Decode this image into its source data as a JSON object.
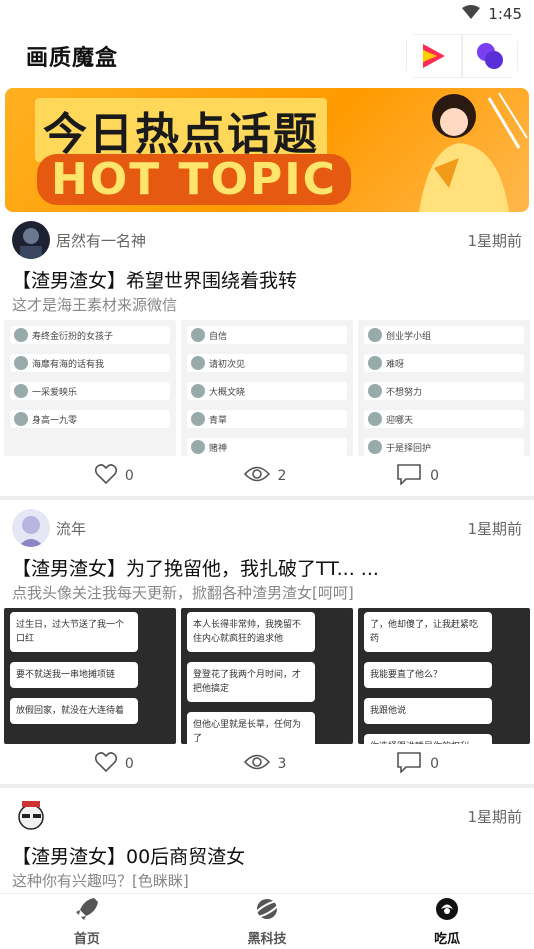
{
  "status_bar": {
    "time": "1:45",
    "wifi_icon": "wifi-icon"
  },
  "header": {
    "title": "画质魔盒",
    "icons": [
      "video-play-icon",
      "bubbles-icon"
    ]
  },
  "banner": {
    "title_cn": "今日热点话题",
    "title_en": "HOT TOPIC"
  },
  "posts": [
    {
      "author": "居然有一名神",
      "time": "1星期前",
      "title": "【渣男渣女】希望世界围绕着我转",
      "subtitle": "这才是海王素材来源微信",
      "likes": "0",
      "views": "2",
      "comments": "0",
      "thumb_lines": [
        [
          "寿终金衍扮的女孩子",
          "海靡有海的话有我",
          "一采爱映乐",
          "身高一九零"
        ],
        [
          "自信",
          "请初次见",
          "大概文晓",
          "青草",
          "赌神"
        ],
        [
          "创业学小组",
          "难呀",
          "不想努力",
          "迎哪天",
          "于是择回护"
        ]
      ]
    },
    {
      "author": "流年",
      "time": "1星期前",
      "title": "【渣男渣女】为了挽留他，我扎破了TT... ...",
      "subtitle": "点我头像关注我每天更新，掀翻各种渣男渣女[呵呵]",
      "likes": "0",
      "views": "3",
      "comments": "0",
      "thumb_lines": [
        [
          "过生日，过大节送了我一个口红",
          "要不就送我一串地摊项链",
          "放假回家，就没在大连待着"
        ],
        [
          "本人长得非常帅，我挽留不住内心就疯狂的追求他",
          "登登花了我两个月时间，才把他搞定",
          "但他心里就是长草，任何为了"
        ],
        [
          "了，他却傻了，让我赶紧吃药",
          "我能要直了他么？",
          "我跟他说",
          "你选择跟谁睡是你的权利，生不生是我的权利"
        ]
      ]
    },
    {
      "author": "",
      "time": "1星期前",
      "title": "【渣男渣女】00后商贸渣女",
      "subtitle": "这种你有兴趣吗？[色眯眯]"
    }
  ],
  "bottom_nav": [
    {
      "label": "首页",
      "icon": "rocket-icon"
    },
    {
      "label": "黑科技",
      "icon": "planet-icon"
    },
    {
      "label": "吃瓜",
      "icon": "melon-icon",
      "active": true
    }
  ]
}
